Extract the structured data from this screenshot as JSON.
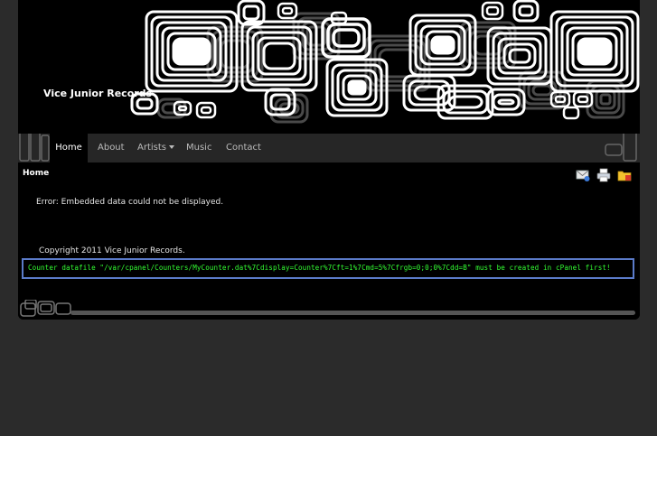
{
  "site": {
    "title": "Vice Junior Records",
    "header_art": "retro-rounded-squares-pattern"
  },
  "nav": {
    "items": [
      {
        "label": "Home",
        "active": true
      },
      {
        "label": "About",
        "active": false
      },
      {
        "label": "Artists",
        "active": false,
        "has_dropdown": true
      },
      {
        "label": "Music",
        "active": false
      },
      {
        "label": "Contact",
        "active": false
      }
    ]
  },
  "content": {
    "page_title": "Home",
    "icons": [
      "email-icon",
      "print-icon",
      "pdf-folder-icon"
    ],
    "error_message": "Error: Embedded data could not be displayed.",
    "copyright": "Copyright 2011 Vice Junior Records.",
    "counter_message": "Counter datafile \"/var/cpanel/Counters/MyCounter.dat%7Cdisplay=Counter%7Cft=1%7Cmd=5%7Cfrgb=0;0;0%7Cdd=B\" must be created in cPanel first!"
  },
  "colors": {
    "page_background": "#2b2b2b",
    "site_background": "#000000",
    "nav_background": "#262626",
    "counter_text": "#33ff33",
    "counter_border": "#5b7bc9"
  }
}
